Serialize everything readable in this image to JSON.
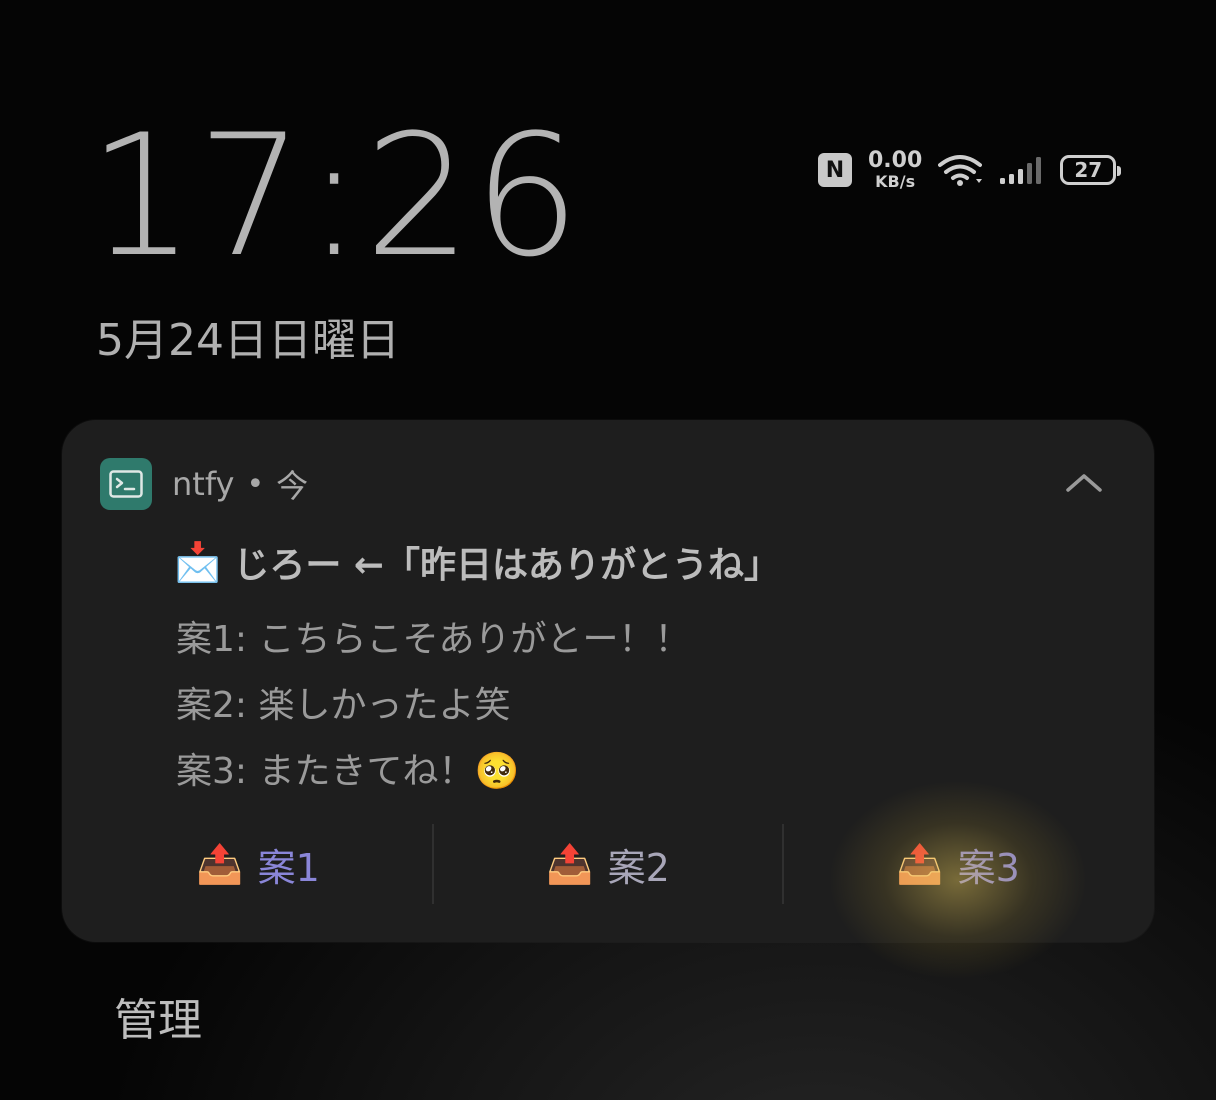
{
  "lockscreen": {
    "time": "17:26",
    "date": "5月24日日曜日"
  },
  "status_bar": {
    "nfc_icon": "N",
    "net_speed_value": "0.00",
    "net_speed_unit": "KB/s",
    "battery_level": "27"
  },
  "notification": {
    "app_name": "ntfy",
    "separator": "•",
    "time": "今",
    "title_emoji": "📩",
    "title": "じろー ←「昨日はありがとうね」",
    "lines": [
      "案1: こちらこそありがとー！！",
      "案2: 楽しかったよ笑",
      "案3: またきてね！🥺"
    ],
    "actions": [
      {
        "emoji": "📤",
        "label": "案1"
      },
      {
        "emoji": "📤",
        "label": "案2"
      },
      {
        "emoji": "📤",
        "label": "案3"
      }
    ]
  },
  "footer": {
    "manage_label": "管理"
  },
  "colors": {
    "app_icon": "#2f7a6c",
    "action_text": "#8a86d8",
    "card_bg": "#1e1e1e"
  }
}
